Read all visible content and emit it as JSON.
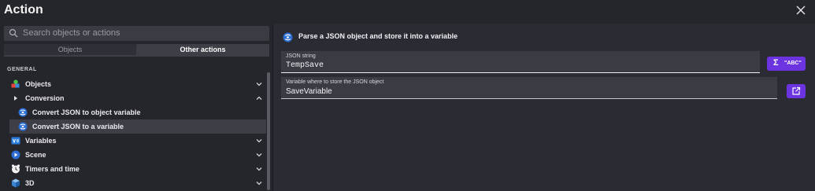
{
  "window": {
    "title": "Action"
  },
  "search": {
    "placeholder": "Search objects or actions"
  },
  "tabs": [
    {
      "label": "Objects"
    },
    {
      "label": "Other actions"
    }
  ],
  "section_title": "GENERAL",
  "tree": [
    {
      "label": "Objects",
      "icon": "objects-icon"
    },
    {
      "label": "Conversion",
      "icon": "caret-right-icon"
    },
    {
      "label": "Convert JSON to object variable",
      "icon": "json-action-icon"
    },
    {
      "label": "Convert JSON to a variable",
      "icon": "json-action-icon",
      "selected": true
    },
    {
      "label": "Variables",
      "icon": "variables-icon"
    },
    {
      "label": "Scene",
      "icon": "scene-icon"
    },
    {
      "label": "Timers and time",
      "icon": "timer-icon"
    },
    {
      "label": "3D",
      "icon": "cube-icon"
    }
  ],
  "action": {
    "description": "Parse a JSON object and store it into a variable",
    "fields": [
      {
        "label": "JSON string",
        "value": "TempSave"
      },
      {
        "label": "Variable where to store the JSON object",
        "value": "SaveVariable"
      }
    ],
    "expression_button": {
      "label": "\"ABC\""
    }
  },
  "colors": {
    "accent": "#6b34e0",
    "panel": "#2b2b33",
    "sidebar": "#25252c"
  }
}
